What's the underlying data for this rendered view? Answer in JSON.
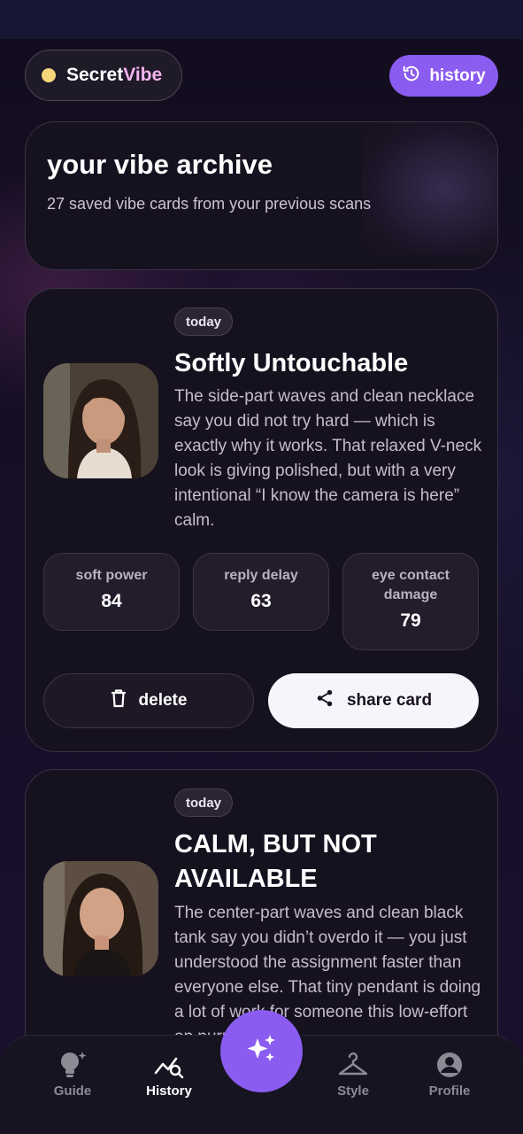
{
  "app": {
    "brand_a": "Secret",
    "brand_b": "Vibe"
  },
  "header": {
    "history_label": "history"
  },
  "archive": {
    "title": "your vibe archive",
    "subtitle": "27 saved vibe cards from your previous scans"
  },
  "cards": [
    {
      "badge": "today",
      "title": "Softly Untouchable",
      "description": "The side-part waves and clean necklace say you did not try hard — which is exactly why it works. That relaxed V-neck look is giving polished, but with a very intentional “I know the camera is here” calm.",
      "stats": [
        {
          "label": "soft power",
          "value": "84"
        },
        {
          "label": "reply delay",
          "value": "63"
        },
        {
          "label": "eye contact damage",
          "value": "79"
        }
      ],
      "delete_label": "delete",
      "share_label": "share card"
    },
    {
      "badge": "today",
      "title": "CALM, BUT NOT AVAILABLE",
      "description": "The center-part waves and clean black tank say you didn’t overdo it — you just understood the assignment faster than everyone else. That tiny pendant is doing a lot of work for someone this low-effort on purpose."
    }
  ],
  "nav": {
    "items": [
      {
        "label": "Guide",
        "icon": "lightbulb-sparkle-icon"
      },
      {
        "label": "History",
        "icon": "chart-search-icon",
        "active": true
      },
      {
        "label": "Style",
        "icon": "hanger-icon"
      },
      {
        "label": "Profile",
        "icon": "account-circle-icon"
      }
    ],
    "fab_icon": "sparkles-icon"
  },
  "colors": {
    "accent": "#8a5cf0",
    "brand_pink": "#f4b4ee",
    "dot": "#f6d67a",
    "bg": "#120c1e"
  }
}
